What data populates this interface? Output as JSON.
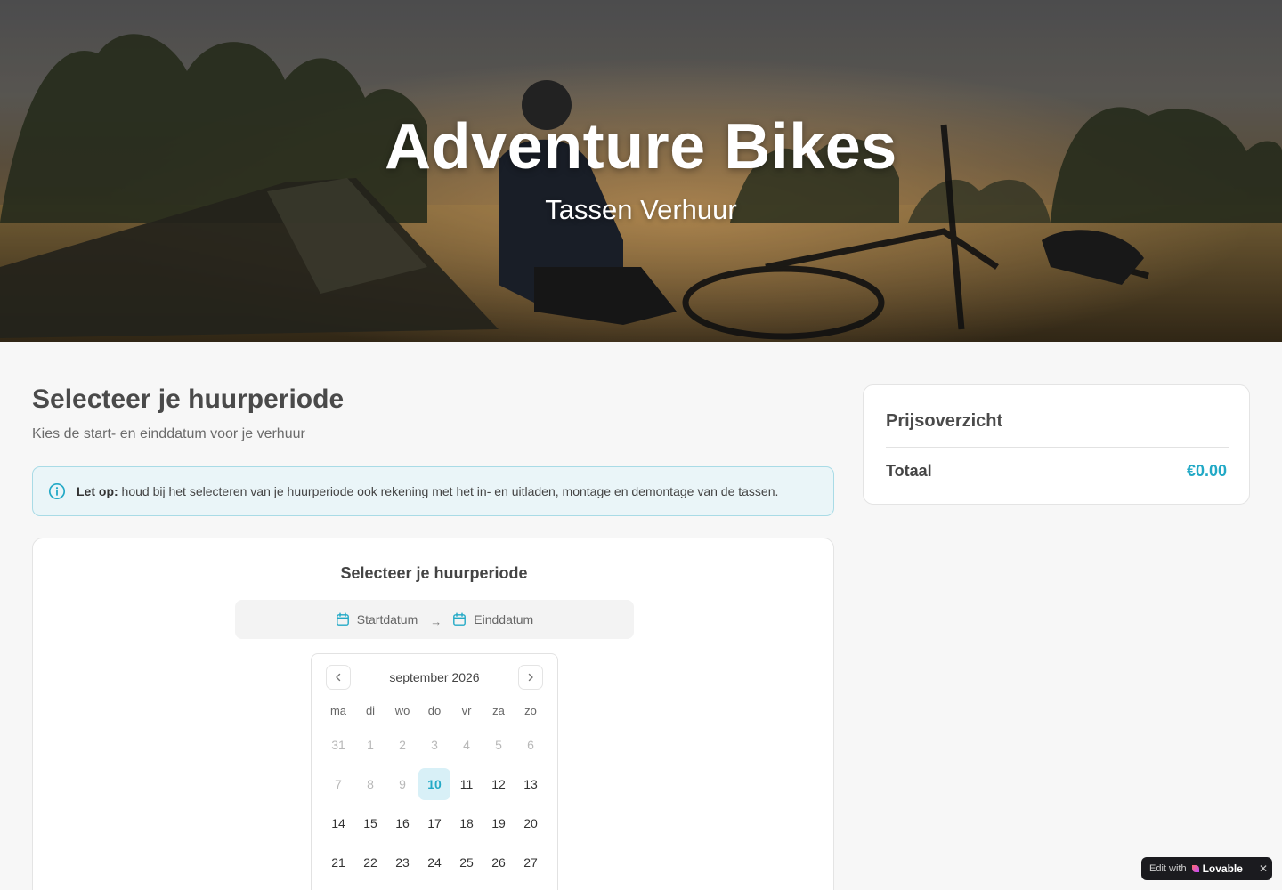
{
  "hero": {
    "title": "Adventure Bikes",
    "subtitle": "Tassen Verhuur"
  },
  "main": {
    "title": "Selecteer je huurperiode",
    "subtitle": "Kies de start- en einddatum voor je verhuur",
    "notice": {
      "icon": "info-icon",
      "bold": "Let op:",
      "text": "houd bij het selecteren van je huurperiode ook rekening met het in- en uitladen, montage en demontage van de tassen."
    },
    "calendar_card": {
      "title": "Selecteer je huurperiode",
      "start_label": "Startdatum",
      "arrow": "→",
      "end_label": "Einddatum",
      "month_label": "september 2026",
      "weekdays": [
        "ma",
        "di",
        "wo",
        "do",
        "vr",
        "za",
        "zo"
      ],
      "weeks": [
        [
          {
            "d": "31",
            "s": "muted"
          },
          {
            "d": "1",
            "s": "muted"
          },
          {
            "d": "2",
            "s": "muted"
          },
          {
            "d": "3",
            "s": "muted"
          },
          {
            "d": "4",
            "s": "muted"
          },
          {
            "d": "5",
            "s": "muted"
          },
          {
            "d": "6",
            "s": "muted"
          }
        ],
        [
          {
            "d": "7",
            "s": "muted"
          },
          {
            "d": "8",
            "s": "muted"
          },
          {
            "d": "9",
            "s": "muted"
          },
          {
            "d": "10",
            "s": "today"
          },
          {
            "d": "11",
            "s": ""
          },
          {
            "d": "12",
            "s": ""
          },
          {
            "d": "13",
            "s": ""
          }
        ],
        [
          {
            "d": "14",
            "s": ""
          },
          {
            "d": "15",
            "s": ""
          },
          {
            "d": "16",
            "s": ""
          },
          {
            "d": "17",
            "s": ""
          },
          {
            "d": "18",
            "s": ""
          },
          {
            "d": "19",
            "s": ""
          },
          {
            "d": "20",
            "s": ""
          }
        ],
        [
          {
            "d": "21",
            "s": ""
          },
          {
            "d": "22",
            "s": ""
          },
          {
            "d": "23",
            "s": ""
          },
          {
            "d": "24",
            "s": ""
          },
          {
            "d": "25",
            "s": ""
          },
          {
            "d": "26",
            "s": ""
          },
          {
            "d": "27",
            "s": ""
          }
        ]
      ]
    }
  },
  "price": {
    "title": "Prijsoverzicht",
    "total_label": "Totaal",
    "total_value": "€0.00"
  },
  "badge": {
    "edit": "Edit with",
    "brand": "Lovable",
    "close": "✕"
  },
  "colors": {
    "accent": "#22a9c6",
    "notice_bg": "#eaf5f8",
    "today_bg": "#d8f0f7"
  }
}
